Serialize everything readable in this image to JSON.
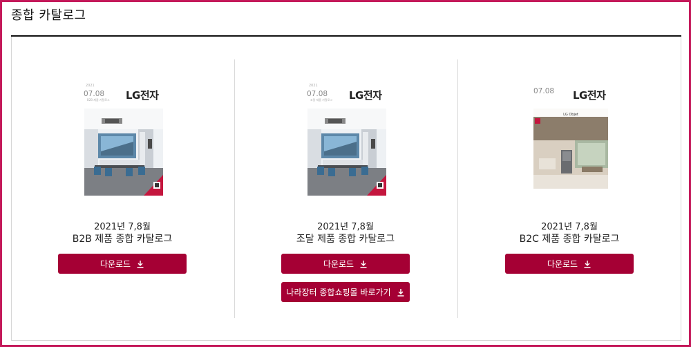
{
  "page": {
    "title": "종합 카탈로그"
  },
  "colors": {
    "accent": "#a50034",
    "frame": "#c4195a"
  },
  "cards": [
    {
      "cover": {
        "date": "07.08",
        "brand": "LG전자",
        "variant": "office"
      },
      "date": "2021년 7,8월",
      "title": "B2B 제품 종합 카탈로그",
      "buttons": [
        "다운로드"
      ]
    },
    {
      "cover": {
        "date": "07.08",
        "brand": "LG전자",
        "variant": "office"
      },
      "date": "2021년 7,8월",
      "title": "조달 제품 종합 카탈로그",
      "buttons": [
        "다운로드",
        "나라장터 종합쇼핑몰 바로가기"
      ]
    },
    {
      "cover": {
        "date": "07.08",
        "brand": "LG전자",
        "variant": "home",
        "cover_title": "LG Objet"
      },
      "date": "2021년 7,8월",
      "title": "B2C 제품 종합 카탈로그",
      "buttons": [
        "다운로드"
      ]
    }
  ],
  "icons": {
    "download": "download-arrow-icon"
  }
}
